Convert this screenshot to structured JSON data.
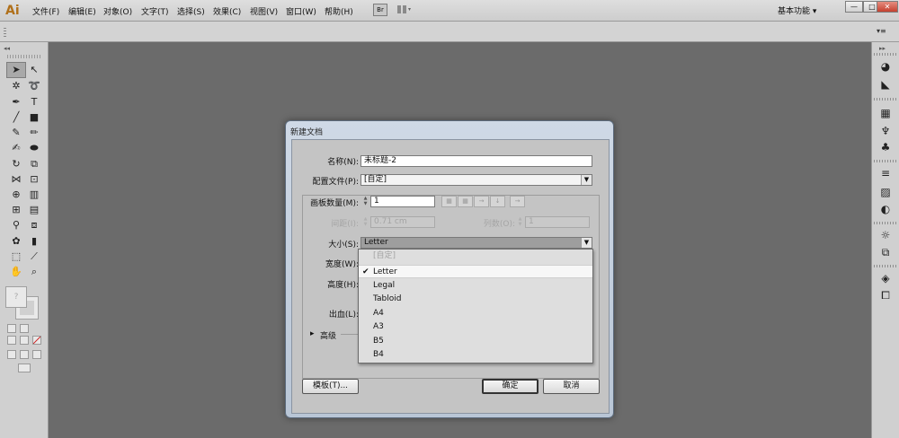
{
  "app": {
    "logo": "Ai"
  },
  "menubar": {
    "items": [
      "文件(F)",
      "编辑(E)",
      "对象(O)",
      "文字(T)",
      "选择(S)",
      "效果(C)",
      "视图(V)",
      "窗口(W)",
      "帮助(H)"
    ],
    "bridge_label": "Br",
    "workspace": "基本功能 ▾",
    "window_buttons": {
      "minimize": "—",
      "restore": "□",
      "close": "✕"
    }
  },
  "toolbar": {
    "collapse": "◂◂",
    "fill_placeholder": "?"
  },
  "dock": {
    "collapse": "▸▸"
  },
  "dialog": {
    "title": "新建文档",
    "name_label": "名称(N):",
    "name_value": "未标题-2",
    "profile_label": "配置文件(P):",
    "profile_value": "[自定]",
    "artboards_label": "画板数量(M):",
    "artboards_value": "1",
    "spacing_label": "间距(I):",
    "spacing_value": "0.71 cm",
    "columns_label": "列数(O):",
    "columns_value": "1",
    "size_label": "大小(S):",
    "size_value": "Letter",
    "width_label": "宽度(W):",
    "height_label": "高度(H):",
    "bleed_label": "出血(L):",
    "advanced_label": "高级",
    "templates_button": "模板(T)...",
    "ok_button": "确定",
    "cancel_button": "取消"
  },
  "size_dropdown": {
    "options": [
      "[自定]",
      "Letter",
      "Legal",
      "Tabloid",
      "A4",
      "A3",
      "B5",
      "B4"
    ],
    "selected": "Letter",
    "disabled": "[自定]",
    "check_glyph": "✔"
  },
  "colors": {
    "canvas": "#6b6b6b",
    "panel": "#d0d0d0",
    "dialog_frame": "#c2cedc",
    "logo": "#b0701a"
  }
}
